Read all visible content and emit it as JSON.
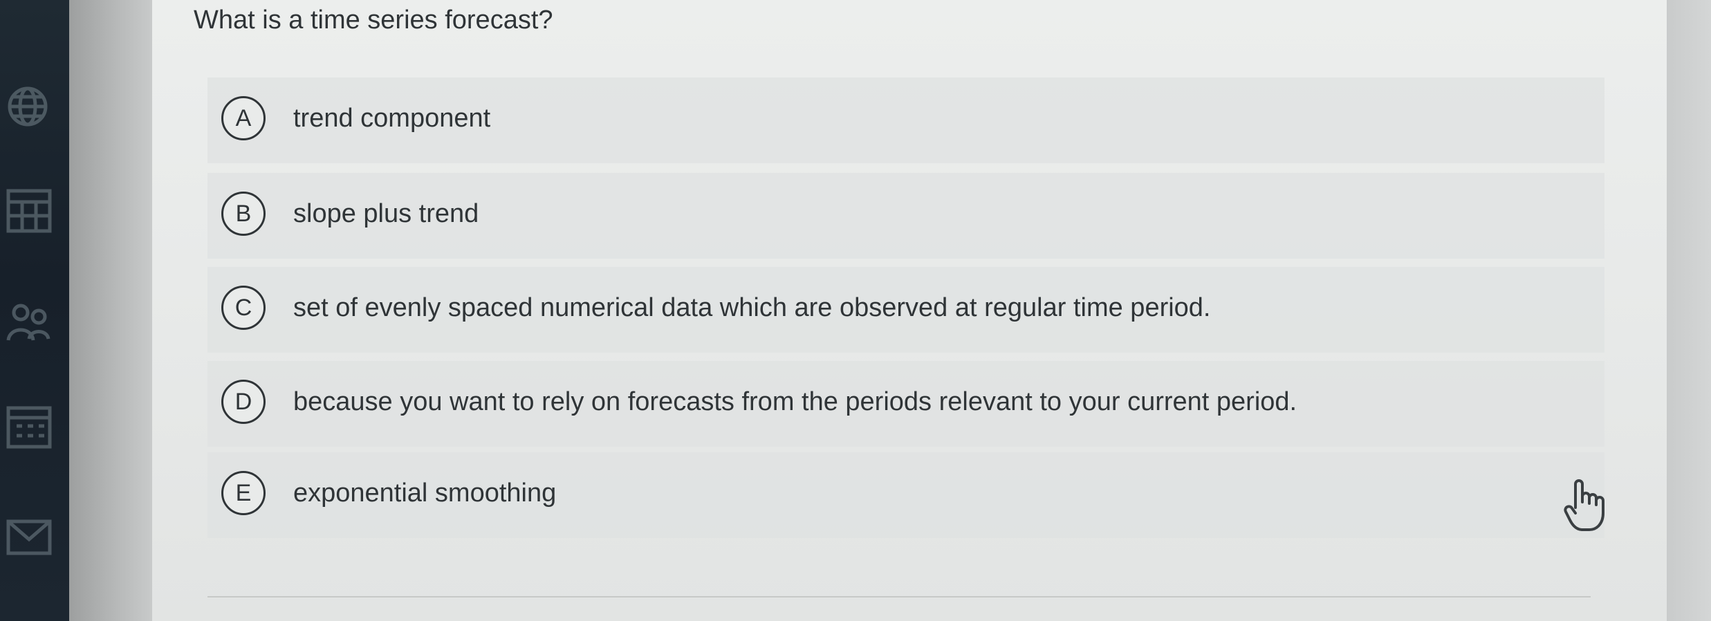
{
  "question": {
    "text": "What is a time series forecast?"
  },
  "options": [
    {
      "letter": "A",
      "text": "trend component"
    },
    {
      "letter": "B",
      "text": "slope plus trend"
    },
    {
      "letter": "C",
      "text": "set of evenly spaced numerical data which are observed at regular time period."
    },
    {
      "letter": "D",
      "text": "because you want to rely on forecasts from the periods relevant to your current period."
    },
    {
      "letter": "E",
      "text": "exponential smoothing"
    }
  ],
  "sidebar": {
    "icons": [
      "globe-icon",
      "calculator-icon",
      "people-icon",
      "calendar-icon",
      "mail-icon"
    ]
  },
  "cursor": {
    "icon": "hand-pointer-icon"
  },
  "colors": {
    "text": "#2f3437",
    "panel": "#eceeed",
    "rail": "#1f2a33"
  }
}
